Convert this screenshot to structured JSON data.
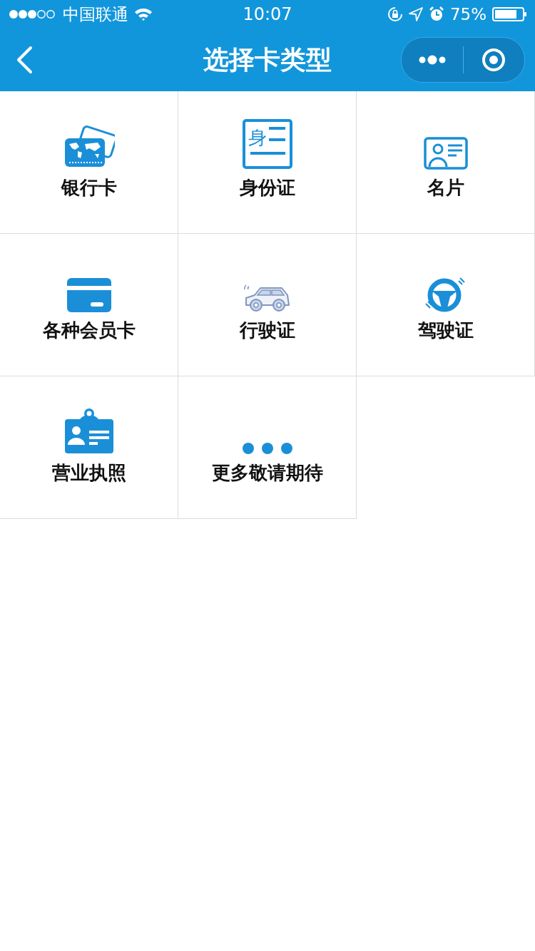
{
  "status_bar": {
    "carrier": "中国联通",
    "time": "10:07",
    "battery": "75%"
  },
  "nav": {
    "title": "选择卡类型"
  },
  "cards": [
    {
      "kind": "bank",
      "label": "银行卡"
    },
    {
      "kind": "id",
      "label": "身份证",
      "icon_text": "身"
    },
    {
      "kind": "namecard",
      "label": "名片"
    },
    {
      "kind": "member",
      "label": "各种会员卡"
    },
    {
      "kind": "vehicle",
      "label": "行驶证"
    },
    {
      "kind": "driver",
      "label": "驾驶证"
    },
    {
      "kind": "license",
      "label": "营业执照"
    },
    {
      "kind": "more",
      "label": "更多敬请期待"
    }
  ]
}
